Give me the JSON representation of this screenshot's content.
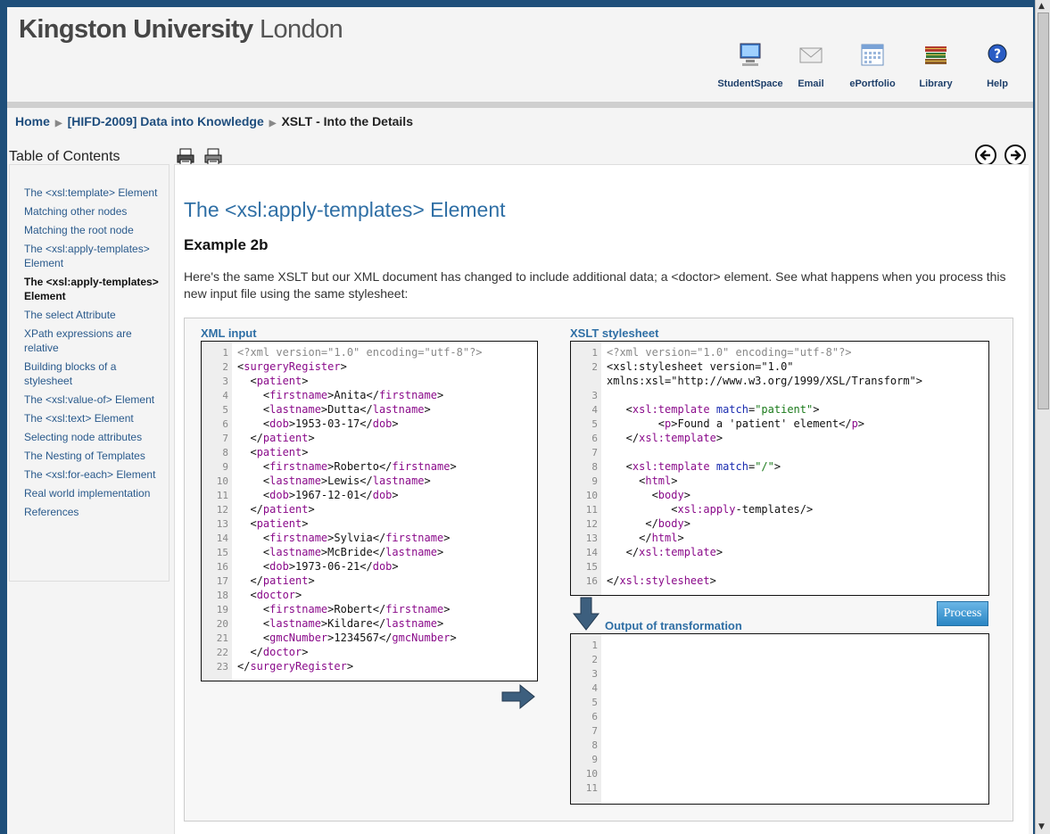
{
  "header": {
    "logo_brand": "Kingston University",
    "logo_city": "London",
    "links": [
      {
        "label": "StudentSpace",
        "icon": "monitor-icon"
      },
      {
        "label": "Email",
        "icon": "envelope-icon"
      },
      {
        "label": "ePortfolio",
        "icon": "calendar-icon"
      },
      {
        "label": "Library",
        "icon": "books-icon"
      },
      {
        "label": "Help",
        "icon": "help-icon"
      }
    ]
  },
  "breadcrumb": {
    "home": "Home",
    "course": "[HIFD-2009] Data into Knowledge",
    "current": "XSLT - Into the Details"
  },
  "toc": {
    "title": "Table of Contents",
    "items": [
      "The <xsl:template> Element",
      "Matching other nodes",
      "Matching the root node",
      "The <xsl:apply-templates> Element",
      "The <xsl:apply-templates> Element",
      "The select Attribute",
      "XPath expressions are relative",
      "Building blocks of a stylesheet",
      "The <xsl:value-of> Element",
      "The <xsl:text> Element",
      "Selecting node attributes",
      "The Nesting of Templates",
      "The <xsl:for-each> Element",
      "Real world implementation",
      "References"
    ],
    "active_index": 4
  },
  "content": {
    "heading": "The <xsl:apply-templates> Element",
    "subheading": "Example 2b",
    "paragraph": "Here's the same XSLT but our XML document has changed to include additional data; a <doctor> element. See what happens when you process this new input file using the same stylesheet:",
    "xml_label": "XML input",
    "xslt_label": "XSLT stylesheet",
    "output_label": "Output of transformation",
    "process_label": "Process",
    "xml_lines": [
      "<?xml version=\"1.0\" encoding=\"utf-8\"?>",
      "<surgeryRegister>",
      "  <patient>",
      "    <firstname>Anita</firstname>",
      "    <lastname>Dutta</lastname>",
      "    <dob>1953-03-17</dob>",
      "  </patient>",
      "  <patient>",
      "    <firstname>Roberto</firstname>",
      "    <lastname>Lewis</lastname>",
      "    <dob>1967-12-01</dob>",
      "  </patient>",
      "  <patient>",
      "    <firstname>Sylvia</firstname>",
      "    <lastname>McBride</lastname>",
      "    <dob>1973-06-21</dob>",
      "  </patient>",
      "  <doctor>",
      "    <firstname>Robert</firstname>",
      "    <lastname>Kildare</lastname>",
      "    <gmcNumber>1234567</gmcNumber>",
      "  </doctor>",
      "</surgeryRegister>"
    ],
    "xslt_lines": [
      "<?xml version=\"1.0\" encoding=\"utf-8\"?>",
      "<xsl:stylesheet version=\"1.0\"",
      "xmlns:xsl=\"http://www.w3.org/1999/XSL/Transform\">",
      "",
      "   <xsl:template match=\"patient\">",
      "        <p>Found a 'patient' element</p>",
      "   </xsl:template>",
      "",
      "   <xsl:template match=\"/\">",
      "     <html>",
      "       <body>",
      "          <xsl:apply-templates/>",
      "      </body>",
      "     </html>",
      "   </xsl:template>",
      "",
      "</xsl:stylesheet>"
    ],
    "xslt_line_numbers": [
      1,
      2,
      null,
      3,
      4,
      5,
      6,
      7,
      8,
      9,
      10,
      11,
      12,
      13,
      14,
      15,
      16
    ],
    "output_line_numbers": [
      "1",
      "2",
      "3",
      "4",
      "5",
      "6",
      "7",
      "8",
      "9",
      "10",
      "11"
    ]
  }
}
